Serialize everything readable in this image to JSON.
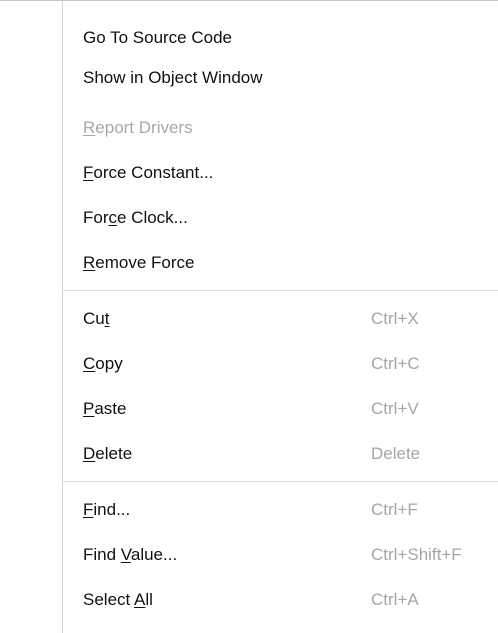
{
  "context_menu": {
    "groups": [
      {
        "items": [
          {
            "label": "Go To Source Code",
            "mnemonic": "",
            "shortcut": "",
            "enabled": true
          },
          {
            "label": "Show in Object Window",
            "mnemonic": "",
            "shortcut": "",
            "enabled": true
          },
          {
            "label": "Report Drivers",
            "mnemonic": "R",
            "shortcut": "",
            "enabled": false
          },
          {
            "label": "Force Constant...",
            "mnemonic": "F",
            "shortcut": "",
            "enabled": true
          },
          {
            "label": "Force Clock...",
            "mnemonic": "c",
            "shortcut": "",
            "enabled": true
          },
          {
            "label": "Remove Force",
            "mnemonic": "R",
            "shortcut": "",
            "enabled": true
          }
        ]
      },
      {
        "items": [
          {
            "label": "Cut",
            "mnemonic": "t",
            "shortcut": "Ctrl+X",
            "enabled": true
          },
          {
            "label": "Copy",
            "mnemonic": "C",
            "shortcut": "Ctrl+C",
            "enabled": true
          },
          {
            "label": "Paste",
            "mnemonic": "P",
            "shortcut": "Ctrl+V",
            "enabled": true
          },
          {
            "label": "Delete",
            "mnemonic": "D",
            "shortcut": "Delete",
            "enabled": true
          }
        ]
      },
      {
        "items": [
          {
            "label": "Find...",
            "mnemonic": "F",
            "shortcut": "Ctrl+F",
            "enabled": true
          },
          {
            "label": "Find Value...",
            "mnemonic": "V",
            "shortcut": "Ctrl+Shift+F",
            "enabled": true
          },
          {
            "label": "Select All",
            "mnemonic": "A",
            "shortcut": "Ctrl+A",
            "enabled": true
          }
        ]
      }
    ]
  }
}
